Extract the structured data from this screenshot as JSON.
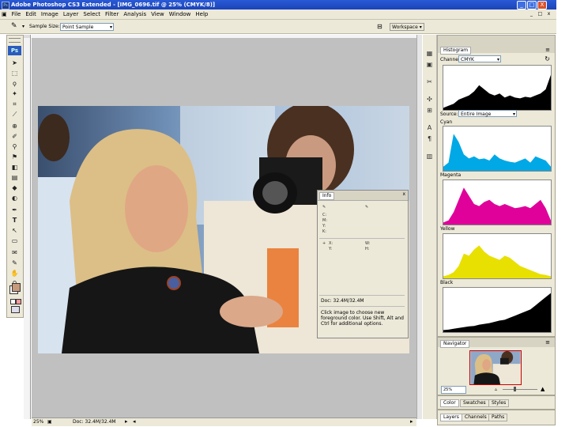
{
  "window": {
    "title": "Adobe Photoshop CS3 Extended - [IMG_0696.tif @ 25% (CMYK/8)]",
    "min_label": "_",
    "max_label": "□",
    "close_label": "X"
  },
  "menu": {
    "items": [
      "File",
      "Edit",
      "Image",
      "Layer",
      "Select",
      "Filter",
      "Analysis",
      "View",
      "Window",
      "Help"
    ],
    "doc_min": "_",
    "doc_max": "□",
    "doc_close": "x"
  },
  "options": {
    "style_label": "Sample Size:",
    "style_value": "Point Sample",
    "workspace_label": "Workspace ▾"
  },
  "toolbox": {
    "ps_logo": "Ps",
    "fg_color": "#ffffff",
    "bg_color": "#c79a7c"
  },
  "info_panel": {
    "tab": "Info",
    "c_label": "C:",
    "m_label": "M:",
    "y_label": "Y:",
    "k_label": "K:",
    "x_label": "X:",
    "y2_label": "Y:",
    "w_label": "W:",
    "h_label": "H:",
    "doc": "Doc: 32.4M/32.4M",
    "help": "Click image to choose new foreground color. Use Shift, Alt and Ctrl for additional options."
  },
  "histogram": {
    "tab": "Histogram",
    "channel_label": "Channel:",
    "channel_value": "CMYK",
    "source_label": "Source:",
    "source_value": "Entire Image",
    "channels": [
      {
        "name": "",
        "color": "#000000"
      },
      {
        "name": "Cyan",
        "color": "#00a8e6"
      },
      {
        "name": "Magenta",
        "color": "#e0009a"
      },
      {
        "name": "Yellow",
        "color": "#e8e000"
      },
      {
        "name": "Black",
        "color": "#000000"
      }
    ]
  },
  "navigator": {
    "tab": "Navigator",
    "zoom": "25%"
  },
  "color_tabs": [
    "Color",
    "Swatches",
    "Styles"
  ],
  "layer_tabs": [
    "Layers",
    "Channels",
    "Paths"
  ],
  "status": {
    "zoom": "25%",
    "doc": "Doc: 32.4M/32.4M"
  }
}
